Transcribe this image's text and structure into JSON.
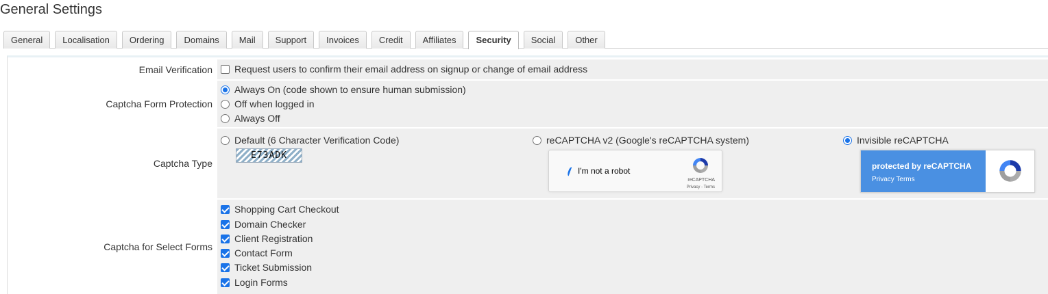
{
  "page": {
    "title": "General Settings"
  },
  "tabs": [
    {
      "label": "General",
      "active": false
    },
    {
      "label": "Localisation",
      "active": false
    },
    {
      "label": "Ordering",
      "active": false
    },
    {
      "label": "Domains",
      "active": false
    },
    {
      "label": "Mail",
      "active": false
    },
    {
      "label": "Support",
      "active": false
    },
    {
      "label": "Invoices",
      "active": false
    },
    {
      "label": "Credit",
      "active": false
    },
    {
      "label": "Affiliates",
      "active": false
    },
    {
      "label": "Security",
      "active": true
    },
    {
      "label": "Social",
      "active": false
    },
    {
      "label": "Other",
      "active": false
    }
  ],
  "email_verification": {
    "label": "Email Verification",
    "option": "Request users to confirm their email address on signup or change of email address",
    "checked": false
  },
  "captcha_protection": {
    "label": "Captcha Form Protection",
    "options": [
      {
        "label": "Always On (code shown to ensure human submission)",
        "selected": true
      },
      {
        "label": "Off when logged in",
        "selected": false
      },
      {
        "label": "Always Off",
        "selected": false
      }
    ]
  },
  "captcha_type": {
    "label": "Captcha Type",
    "options": [
      {
        "label": "Default (6 Character Verification Code)",
        "selected": false
      },
      {
        "label": "reCAPTCHA v2 (Google's reCAPTCHA system)",
        "selected": false
      },
      {
        "label": "Invisible reCAPTCHA",
        "selected": true
      }
    ],
    "default_code": "E73ADK",
    "recaptcha_v2": {
      "checkbox_text": "I'm not a robot",
      "brand": "reCAPTCHA",
      "links": "Privacy - Terms"
    },
    "invisible": {
      "line1": "protected by reCAPTCHA",
      "line2": "Privacy  Terms"
    }
  },
  "captcha_forms": {
    "label": "Captcha for Select Forms",
    "items": [
      {
        "label": "Shopping Cart Checkout",
        "checked": true
      },
      {
        "label": "Domain Checker",
        "checked": true
      },
      {
        "label": "Client Registration",
        "checked": true
      },
      {
        "label": "Contact Form",
        "checked": true
      },
      {
        "label": "Ticket Submission",
        "checked": true
      },
      {
        "label": "Login Forms",
        "checked": true
      }
    ]
  },
  "colors": {
    "accent": "#1a73e8",
    "field_bg": "#efefef",
    "recaptcha_blue": "#4a90e2"
  }
}
